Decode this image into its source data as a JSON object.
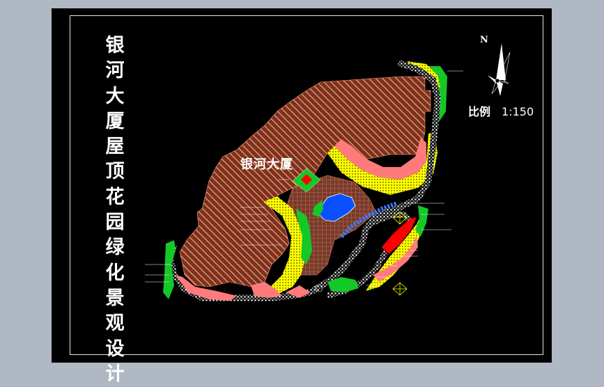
{
  "title": {
    "chars": [
      "银",
      "河",
      "大",
      "厦",
      "屋",
      "顶",
      "花",
      "园",
      "绿",
      "化",
      "景",
      "观",
      "设",
      "计"
    ]
  },
  "building_label": "银河大厦",
  "scale": {
    "label": "比例",
    "value": "1:150"
  },
  "north_label": "N",
  "colors": {
    "background": "#000000",
    "page": "#b0b8c4",
    "hatch": "#ff9a72",
    "yellow": "#ffff00",
    "green": "#14c828",
    "pink": "#ff7a7a",
    "red": "#ff0000",
    "water": "#0a50ff",
    "path": "#ffffff"
  },
  "icons": [
    "north-arrow-icon",
    "compass-rose-icon"
  ]
}
